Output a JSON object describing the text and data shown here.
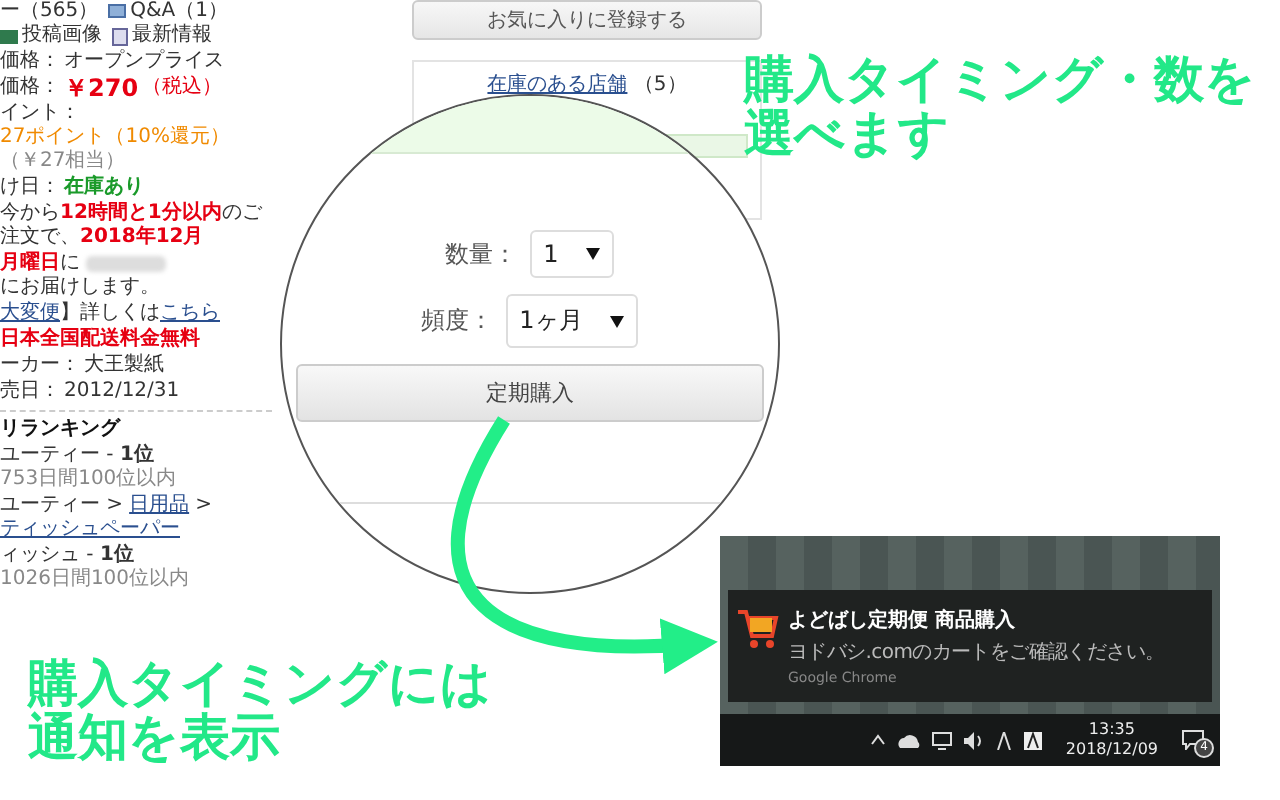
{
  "product_page": {
    "meta_links": [
      {
        "kind": "text",
        "label": "ー（565）"
      },
      {
        "kind": "qa",
        "label": "Q&A（1）"
      },
      {
        "kind": "image",
        "label": "投稿画像"
      },
      {
        "kind": "news",
        "label": "最新情報"
      }
    ],
    "details": [
      {
        "kind": "plain",
        "label": "価格：",
        "value": "オープンプライス"
      },
      {
        "kind": "price",
        "label": "価格：",
        "value": "￥270",
        "note": "（税込）"
      },
      {
        "kind": "points",
        "label": "イント：",
        "value": "27ポイント（10%還元）",
        "note": "（￥27相当）"
      },
      {
        "kind": "stock",
        "label": "け日：",
        "value": "在庫あり"
      }
    ],
    "delivery_note": "今から**12時間と1分以内**のご注文で、**2018年12月**",
    "delivery_day": "**月曜日**に",
    "delivery_suffix": "にお届けします。",
    "info_line": [
      {
        "kind": "link",
        "text": "大変便"
      },
      {
        "kind": "text",
        "text": "】詳しくは"
      },
      {
        "kind": "link",
        "text": "こちら"
      }
    ],
    "shipping": "日本全国配送料金無料",
    "specs": [
      {
        "label": "ーカー：",
        "value": "大王製紙"
      },
      {
        "label": "売日：",
        "value": "2012/12/31"
      }
    ],
    "ranking": {
      "title": "リランキング",
      "lines": [
        [
          {
            "kind": "text",
            "text": "ユーティー - **1位**"
          },
          {
            "kind": "muted",
            "text": "753日間100位以内"
          }
        ],
        [
          {
            "kind": "text",
            "text": "ユーティー >"
          },
          {
            "kind": "link",
            "text": "日用品"
          },
          {
            "kind": "text",
            "text": ">"
          },
          {
            "kind": "link",
            "text": "ティッシュペーパー"
          }
        ],
        [
          {
            "kind": "text",
            "text": "ィッシュ - **1位**"
          },
          {
            "kind": "muted",
            "text": "1026日間100位以内"
          }
        ]
      ]
    }
  },
  "side_panel": {
    "favorite_button": "お気に入りに登録する",
    "store_link": "在庫のある店舗",
    "store_count": "（5）"
  },
  "magnifier": {
    "fields": [
      {
        "label": "数量：",
        "value": "1"
      },
      {
        "label": "頻度：",
        "value": "1ヶ月"
      }
    ],
    "button": "定期購入"
  },
  "notification_capture": {
    "toast": {
      "title": "よどばし定期便 商品購入",
      "message": "ヨドバシ.comのカートをご確認ください。",
      "source": "Google Chrome"
    },
    "taskbar": {
      "time": "13:35",
      "date": "2018/12/09",
      "badge": "4"
    }
  },
  "captions": [
    {
      "text": "購入タイミング・数を選べます"
    },
    {
      "text": "購入タイミングには通知を表示"
    }
  ]
}
